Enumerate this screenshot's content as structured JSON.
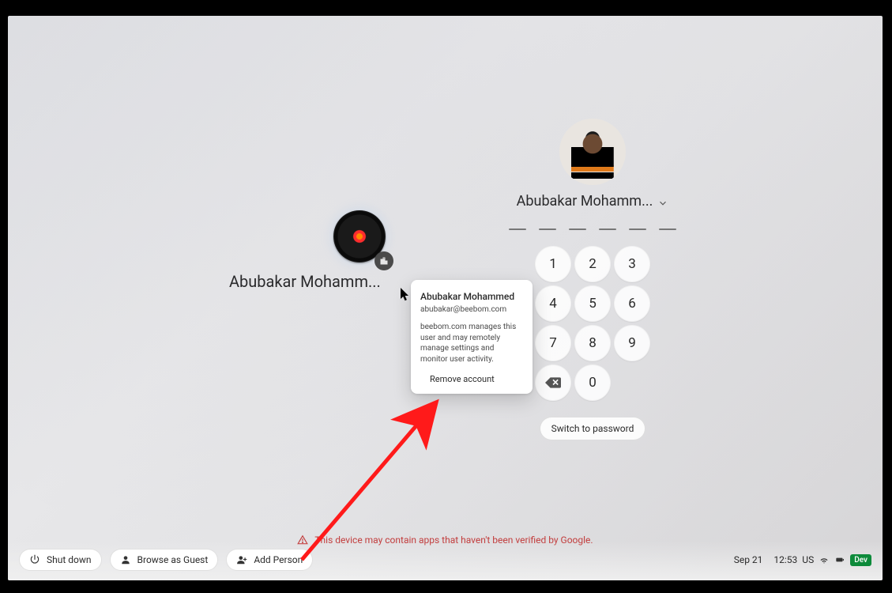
{
  "left_user": {
    "name_truncated": "Abubakar Mohamm..."
  },
  "popover": {
    "name": "Abubakar Mohammed",
    "email": "abubakar@beebom.com",
    "managed_note": "beebom.com manages this user and may remotely manage settings and monitor user activity.",
    "remove_label": "Remove account"
  },
  "right_user": {
    "name_truncated": "Abubakar Mohamm...",
    "pin_length": 6,
    "keypad": [
      "1",
      "2",
      "3",
      "4",
      "5",
      "6",
      "7",
      "8",
      "9",
      "back",
      "0",
      "blank"
    ],
    "switch_label": "Switch to password"
  },
  "warning_text": "This device may contain apps that haven't been verified by Google.",
  "bottom": {
    "shutdown": "Shut down",
    "guest": "Browse as Guest",
    "add_person": "Add Person",
    "date": "Sep 21",
    "time": "12:53",
    "kb": "US",
    "dev_badge": "Dev"
  }
}
